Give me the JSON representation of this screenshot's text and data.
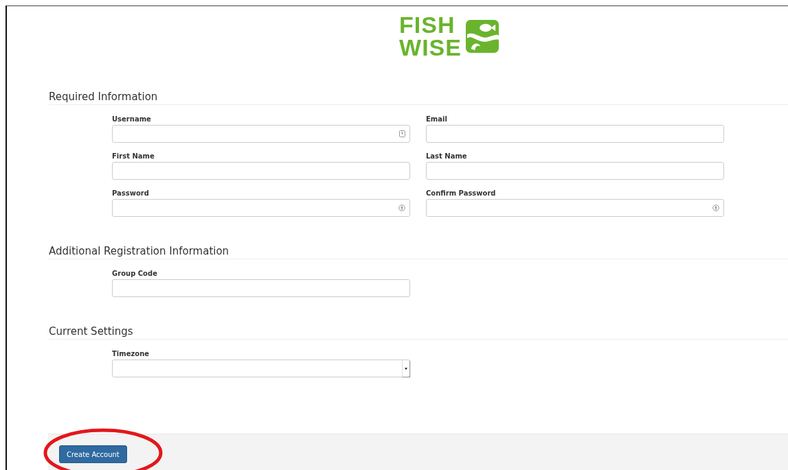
{
  "logo": {
    "line_1": "FISH",
    "line_2": "WISE"
  },
  "sections": [
    {
      "title": "Required Information",
      "fields": [
        {
          "label": "Username",
          "kind": "username"
        },
        {
          "label": "Email",
          "kind": "text"
        },
        {
          "label": "First Name",
          "kind": "text"
        },
        {
          "label": "Last Name",
          "kind": "text"
        },
        {
          "label": "Password",
          "kind": "password"
        },
        {
          "label": "Confirm Password",
          "kind": "password"
        }
      ]
    },
    {
      "title": "Additional Registration Information",
      "fields": [
        {
          "label": "Group Code",
          "kind": "text"
        }
      ]
    },
    {
      "title": "Current Settings",
      "fields": [
        {
          "label": "Timezone",
          "kind": "select"
        }
      ]
    }
  ],
  "submit_button": {
    "label": "Create Account",
    "highlighted": true
  }
}
